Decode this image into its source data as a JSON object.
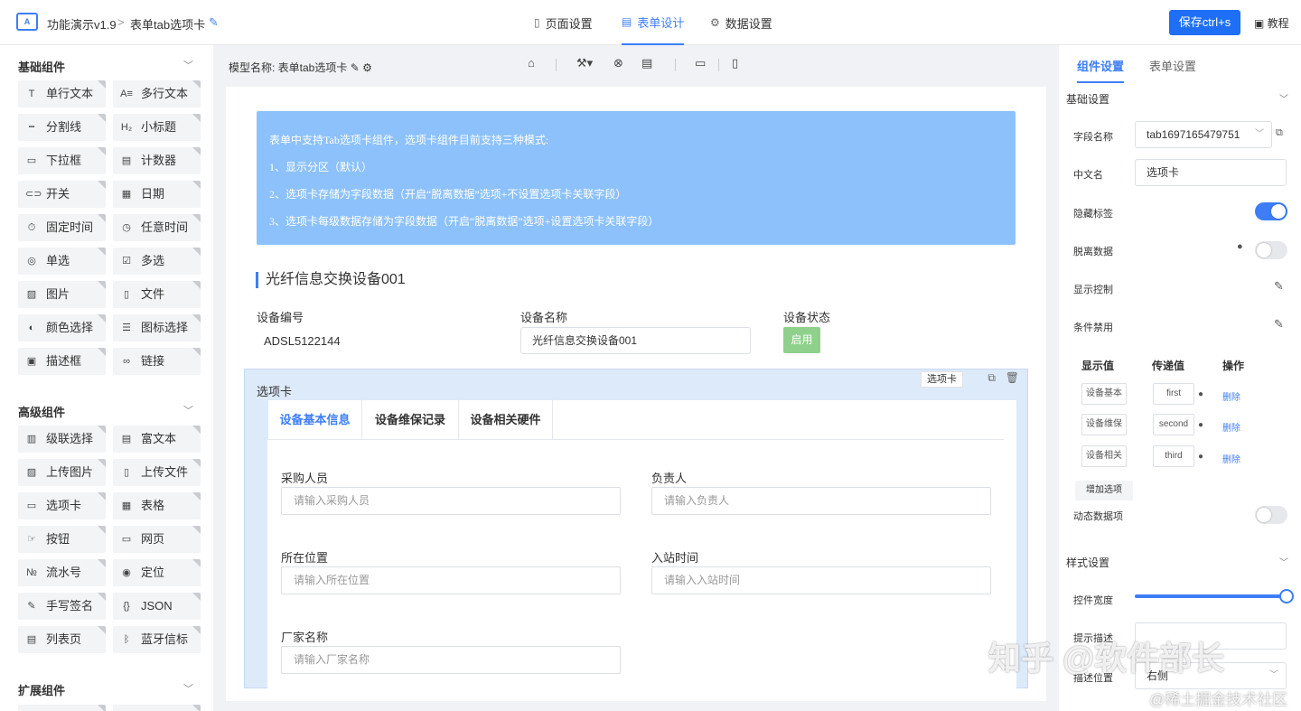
{
  "header": {
    "logo_text": "A",
    "app_name": "功能演示v1.9",
    "separator": ">",
    "form_name": "表单tab选项卡",
    "edit_icon": "pencil-icon",
    "nav": [
      {
        "label": "页面设置",
        "icon": "bookmark-icon",
        "active": false
      },
      {
        "label": "表单设计",
        "icon": "document-icon",
        "active": true
      },
      {
        "label": "数据设置",
        "icon": "gear-icon",
        "active": false
      }
    ],
    "save_label": "保存ctrl+s",
    "tutorial_label": "教程",
    "accent_color": "#1e6ff5"
  },
  "sidebar": {
    "sections": [
      {
        "title": "基础组件",
        "items": [
          {
            "icon": "T",
            "label": "单行文本"
          },
          {
            "icon": "A≡",
            "label": "多行文本"
          },
          {
            "icon": "┅",
            "label": "分割线"
          },
          {
            "icon": "H₂",
            "label": "小标题"
          },
          {
            "icon": "▭",
            "label": "下拉框"
          },
          {
            "icon": "▤",
            "label": "计数器"
          },
          {
            "icon": "⊂⊃",
            "label": "开关"
          },
          {
            "icon": "▦",
            "label": "日期"
          },
          {
            "icon": "⏱",
            "label": "固定时间"
          },
          {
            "icon": "◷",
            "label": "任意时间"
          },
          {
            "icon": "◎",
            "label": "单选"
          },
          {
            "icon": "☑",
            "label": "多选"
          },
          {
            "icon": "▨",
            "label": "图片"
          },
          {
            "icon": "▯",
            "label": "文件"
          },
          {
            "icon": "◐",
            "label": "颜色选择"
          },
          {
            "icon": "☰",
            "label": "图标选择"
          },
          {
            "icon": "▣",
            "label": "描述框"
          },
          {
            "icon": "∞",
            "label": "链接"
          }
        ]
      },
      {
        "title": "高级组件",
        "items": [
          {
            "icon": "▥",
            "label": "级联选择"
          },
          {
            "icon": "▤",
            "label": "富文本"
          },
          {
            "icon": "▨",
            "label": "上传图片"
          },
          {
            "icon": "▯",
            "label": "上传文件"
          },
          {
            "icon": "▭",
            "label": "选项卡"
          },
          {
            "icon": "▦",
            "label": "表格"
          },
          {
            "icon": "☞",
            "label": "按钮"
          },
          {
            "icon": "▭",
            "label": "网页"
          },
          {
            "icon": "№",
            "label": "流水号"
          },
          {
            "icon": "◉",
            "label": "定位"
          },
          {
            "icon": "✎",
            "label": "手写签名"
          },
          {
            "icon": "{}",
            "label": "JSON"
          },
          {
            "icon": "▤",
            "label": "列表页"
          },
          {
            "icon": "ᛒ",
            "label": "蓝牙信标"
          }
        ]
      },
      {
        "title": "扩展组件",
        "items": []
      }
    ]
  },
  "canvas_header": {
    "model_name": "模型名称: 表单tab选项卡",
    "tools": [
      "home-icon",
      "magic-wand-icon",
      "link-icon",
      "keyboard-icon",
      "desktop-icon",
      "mobile-icon"
    ]
  },
  "notice": {
    "lines": [
      "表单中支持Tab选项卡组件，选项卡组件目前支持三种模式:",
      "1、显示分区（默认）",
      "2、选项卡存储为字段数据（开启“脱离数据”选项+不设置选项卡关联字段）",
      "3、选项卡每级数据存储为字段数据（开启“脱离数据”选项+设置选项卡关联字段）"
    ],
    "color": "#8cc1fb"
  },
  "section_title": "光纤信息交换设备001",
  "fields": {
    "device_no_label": "设备编号",
    "device_no_value": "ADSL5122144",
    "device_name_label": "设备名称",
    "device_name_value": "光纤信息交换设备001",
    "device_status_label": "设备状态",
    "device_status_value": "启用"
  },
  "tab_component": {
    "tag_label": "选项卡",
    "title": "选项卡",
    "tabs": [
      "设备基本信息",
      "设备维保记录",
      "设备相关硬件"
    ],
    "fields": [
      {
        "label": "采购人员",
        "placeholder": "请输入采购人员"
      },
      {
        "label": "负责人",
        "placeholder": "请输入负责人"
      },
      {
        "label": "所在位置",
        "placeholder": "请输入所在位置"
      },
      {
        "label": "入站时间",
        "placeholder": "请输入入站时间"
      },
      {
        "label": "厂家名称",
        "placeholder": "请输入厂家名称"
      }
    ]
  },
  "right_panel": {
    "tabs": [
      "组件设置",
      "表单设置"
    ],
    "basic_title": "基础设置",
    "field_name_label": "字段名称",
    "field_name_value": "tab1697165479751",
    "cn_name_label": "中文名",
    "cn_name_value": "选项卡",
    "hide_label_label": "隐藏标签",
    "hide_label_on": true,
    "detach_label": "脱离数据",
    "detach_on": false,
    "display_ctrl_label": "显示控制",
    "cond_disable_label": "条件禁用",
    "table_headers": [
      "显示值",
      "传递值",
      "操作"
    ],
    "options": [
      {
        "display": "设备基本",
        "value": "first",
        "action": "删除"
      },
      {
        "display": "设备维保",
        "value": "second",
        "action": "删除"
      },
      {
        "display": "设备相关",
        "value": "third",
        "action": "删除"
      }
    ],
    "add_option_label": "增加选项",
    "dynamic_label": "动态数据项",
    "dynamic_on": false,
    "style_title": "样式设置",
    "width_label": "控件宽度",
    "width_fraction": 1.0,
    "hint_label": "提示描述",
    "desc_pos_label": "描述位置",
    "desc_pos_value": "右侧"
  },
  "watermark": {
    "main": "知乎 @软件部长",
    "sub": "@稀土掘金技术社区"
  }
}
